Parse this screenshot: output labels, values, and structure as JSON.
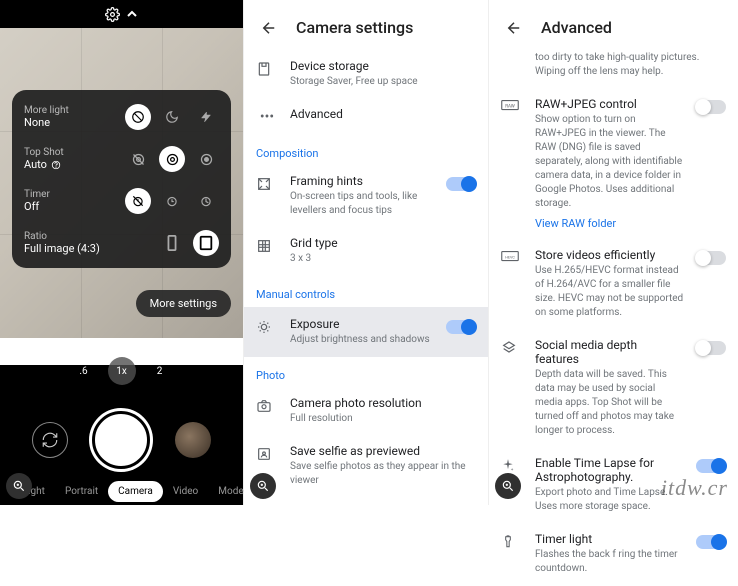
{
  "panel1": {
    "moreLightLabel": "More light",
    "moreLightValue": "None",
    "topShotLabel": "Top Shot",
    "topShotValue": "Auto",
    "timerLabel": "Timer",
    "timerValue": "Off",
    "ratioLabel": "Ratio",
    "ratioValue": "Full image (4:3)",
    "moreSettings": "More settings",
    "zoom": [
      ".6",
      "1x",
      "2"
    ],
    "modes": [
      "it Sight",
      "Portrait",
      "Camera",
      "Video",
      "Modes"
    ]
  },
  "panel2": {
    "title": "Camera settings",
    "deviceStorage": {
      "name": "Device storage",
      "desc": "Storage Saver, Free up space"
    },
    "advanced": {
      "name": "Advanced"
    },
    "sectionComposition": "Composition",
    "framingHints": {
      "name": "Framing hints",
      "desc": "On-screen tips and tools, like levellers and focus tips"
    },
    "gridType": {
      "name": "Grid type",
      "desc": "3 x 3"
    },
    "sectionManual": "Manual controls",
    "exposure": {
      "name": "Exposure",
      "desc": "Adjust brightness and shadows"
    },
    "sectionPhoto": "Photo",
    "resolution": {
      "name": "Camera photo resolution",
      "desc": "Full resolution"
    },
    "selfie": {
      "name": "Save selfie as previewed",
      "desc": "Save selfie photos as they appear in the viewer"
    }
  },
  "panel3": {
    "title": "Advanced",
    "lensHint": "too dirty to take high-quality pictures. Wiping off the lens may help.",
    "rawJpeg": {
      "name": "RAW+JPEG control",
      "desc": "Show option to turn on RAW+JPEG in the viewer. The RAW (DNG) file is saved separately, along with identifiable camera data, in a device folder in Google Photos. Uses additional storage.",
      "link": "View RAW folder"
    },
    "storeVideos": {
      "name": "Store videos efficiently",
      "desc": "Use H.265/HEVC format instead of H.264/AVC for a smaller file size. HEVC may not be supported on some platforms."
    },
    "socialDepth": {
      "name": "Social media depth features",
      "desc": "Depth data will be saved. This data may be used by social media apps. Top Shot will be turned off and photos may take longer to process."
    },
    "timeLapse": {
      "name": "Enable Time Lapse for Astrophotography.",
      "desc": "Export photo and Time Lapse. Uses more storage space."
    },
    "timerLight": {
      "name": "Timer light",
      "desc": "Flashes the back f                ring the timer countdown."
    }
  },
  "watermark": "itdw.cr"
}
